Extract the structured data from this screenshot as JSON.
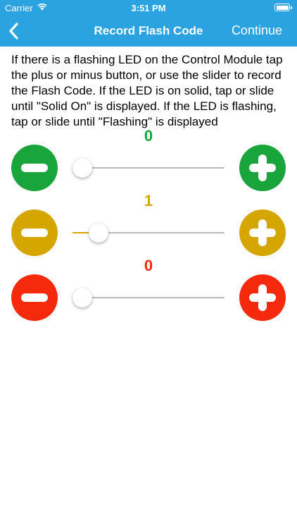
{
  "status_bar": {
    "carrier": "Carrier",
    "time": "3:51 PM",
    "wifi_icon": "wifi-icon",
    "battery_icon": "battery-icon"
  },
  "nav": {
    "back_icon": "chevron-left-icon",
    "title": "Record Flash Code",
    "continue_label": "Continue"
  },
  "instructions": "If there is a flashing LED on the Control Module tap the plus or minus button, or use the slider to record the Flash Code. If the LED is on solid, tap or slide until \"Solid On\" is displayed. If the LED is flashing, tap or slide until \"Flashing\" is displayed",
  "rows": [
    {
      "value": "0",
      "color": "#1aa53c",
      "slider_fraction": 0.0,
      "minus_icon": "minus-icon",
      "plus_icon": "plus-icon"
    },
    {
      "value": "1",
      "color": "#d6a600",
      "slider_fraction": 0.12,
      "minus_icon": "minus-icon",
      "plus_icon": "plus-icon"
    },
    {
      "value": "0",
      "color": "#f52a0c",
      "slider_fraction": 0.0,
      "minus_icon": "minus-icon",
      "plus_icon": "plus-icon"
    }
  ],
  "colors": {
    "nav_background": "#2aa3e0",
    "slider_track": "#b9b9b9"
  }
}
